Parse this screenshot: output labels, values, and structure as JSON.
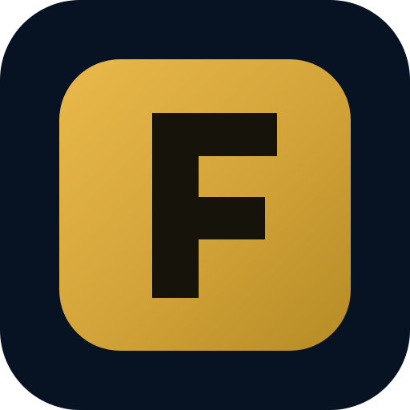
{
  "icon": {
    "letter": "F",
    "colors": {
      "background": "#071223",
      "tile_gradient": [
        "#e9b94b",
        "#d4a53a",
        "#b68c25"
      ],
      "letter": "#16130a"
    }
  }
}
